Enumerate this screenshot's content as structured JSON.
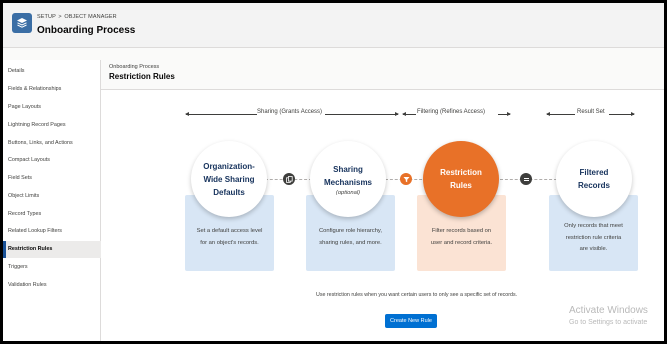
{
  "header": {
    "breadcrumb": [
      "SETUP",
      "OBJECT MANAGER"
    ],
    "breadcrumb_sep": ">",
    "title": "Onboarding Process",
    "icon": "layers-icon"
  },
  "sidebar": {
    "items": [
      {
        "label": "Details",
        "active": false
      },
      {
        "label": "Fields & Relationships",
        "active": false
      },
      {
        "label": "Page Layouts",
        "active": false
      },
      {
        "label": "Lightning Record Pages",
        "active": false
      },
      {
        "label": "Buttons, Links, and Actions",
        "active": false
      },
      {
        "label": "Compact Layouts",
        "active": false
      },
      {
        "label": "Field Sets",
        "active": false
      },
      {
        "label": "Object Limits",
        "active": false
      },
      {
        "label": "Record Types",
        "active": false
      },
      {
        "label": "Related Lookup Filters",
        "active": false
      },
      {
        "label": "Restriction Rules",
        "active": true
      },
      {
        "label": "Triggers",
        "active": false
      },
      {
        "label": "Validation Rules",
        "active": false
      }
    ]
  },
  "main": {
    "subtitle": "Onboarding Process",
    "title": "Restriction Rules"
  },
  "diagram": {
    "stages": {
      "sharing": "Sharing (Grants Access)",
      "filtering": "Filtering (Refines Access)",
      "result": "Result Set"
    },
    "steps": [
      {
        "title_lines": [
          "Organization-",
          "Wide Sharing",
          "Defaults"
        ],
        "subtitle": "",
        "desc_lines": [
          "Set a default access level",
          "for an object's records."
        ]
      },
      {
        "title_lines": [
          "Sharing",
          "Mechanisms"
        ],
        "subtitle": "(optional)",
        "desc_lines": [
          "Configure role hierarchy,",
          "sharing rules, and more."
        ]
      },
      {
        "title_lines": [
          "Restriction",
          "Rules"
        ],
        "subtitle": "",
        "desc_lines": [
          "Filter records based on",
          "user and record criteria."
        ]
      },
      {
        "title_lines": [
          "Filtered",
          "Records"
        ],
        "subtitle": "",
        "desc_lines": [
          "Only records that meet",
          "restriction rule criteria",
          "are visible."
        ]
      }
    ],
    "connectors": [
      "copy-icon",
      "filter-icon",
      "equals-icon"
    ],
    "colors": {
      "blue_panel": "#d8e6f5",
      "orange_panel": "#fbe3d4",
      "accent": "#e87128",
      "title": "#16325c"
    }
  },
  "hint": "Use restriction rules when you want certain users to only see a specific set of records.",
  "new_rule_button": "Create New Rule",
  "watermark": {
    "line1": "Activate Windows",
    "line2": "Go to Settings to activate"
  }
}
